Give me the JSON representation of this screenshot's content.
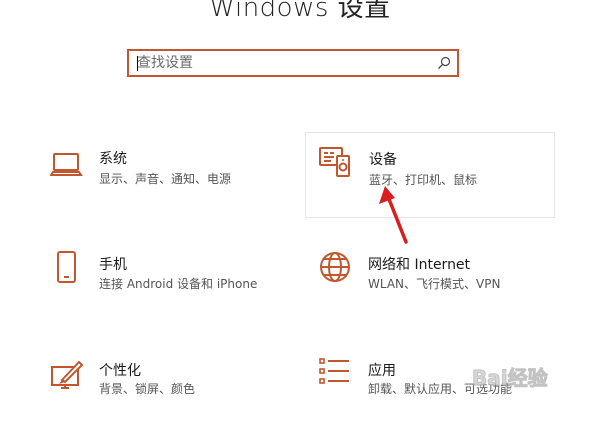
{
  "window": {
    "title": "Windows 设置"
  },
  "search": {
    "placeholder": "查找设置"
  },
  "tiles": [
    {
      "id": "system",
      "name": "系统",
      "desc": "显示、声音、通知、电源",
      "icon": "laptop-icon"
    },
    {
      "id": "devices",
      "name": "设备",
      "desc": "蓝牙、打印机、鼠标",
      "icon": "devices-icon",
      "selected": true
    },
    {
      "id": "phone",
      "name": "手机",
      "desc": "连接 Android 设备和 iPhone",
      "icon": "phone-icon"
    },
    {
      "id": "network",
      "name": "网络和 Internet",
      "desc": "WLAN、飞行模式、VPN",
      "icon": "globe-icon"
    },
    {
      "id": "personal",
      "name": "个性化",
      "desc": "背景、锁屏、颜色",
      "icon": "personalization-icon"
    },
    {
      "id": "apps",
      "name": "应用",
      "desc": "卸载、默认应用、可选功能",
      "icon": "apps-list-icon"
    }
  ],
  "colors": {
    "accent": "#c2572f",
    "arrow": "#d81e1e"
  },
  "watermark": {
    "text": "Bai经验"
  }
}
